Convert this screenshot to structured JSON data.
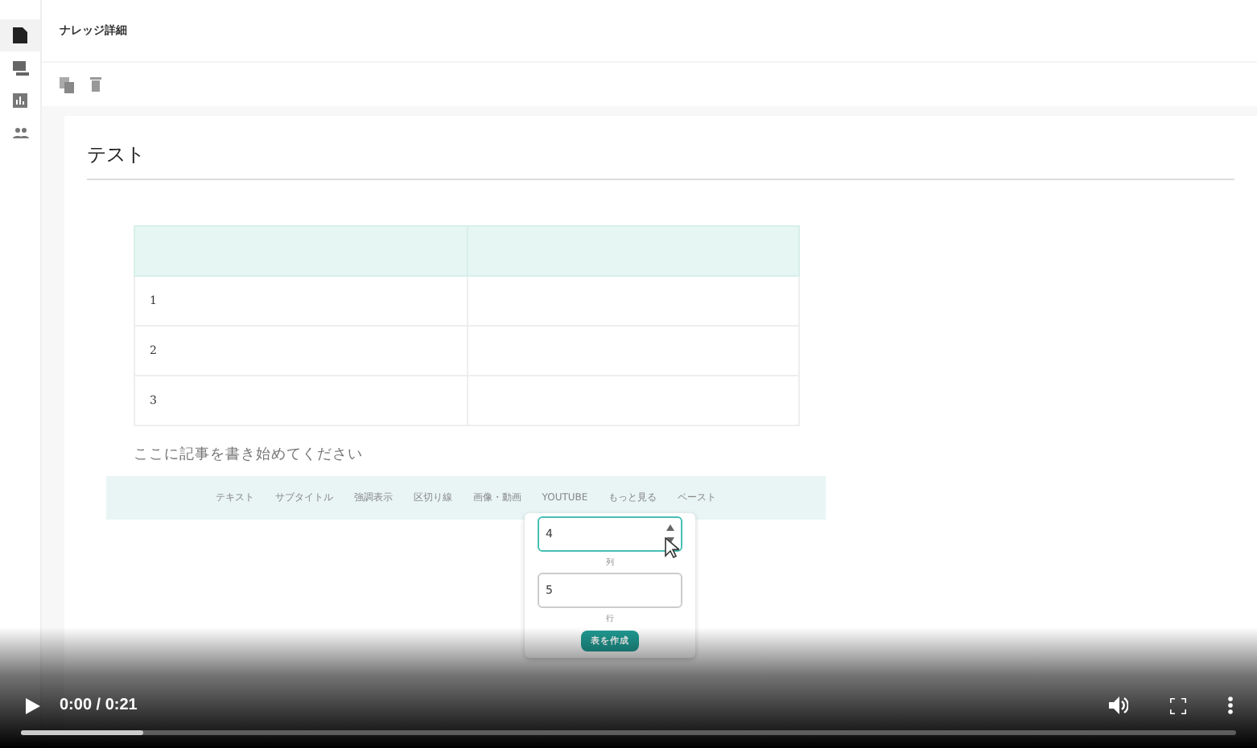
{
  "sidebar": {
    "items": [
      {
        "selected": true
      },
      {
        "selected": false
      },
      {
        "selected": false
      },
      {
        "selected": false
      }
    ]
  },
  "header": {
    "title": "ナレッジ詳細"
  },
  "article": {
    "title": "テスト",
    "table": {
      "rows": [
        [
          "1",
          null
        ],
        [
          "2",
          null
        ],
        [
          "3",
          null
        ]
      ]
    },
    "placeholder": "ここに記事を書き始めてください",
    "insert_toolbar": [
      "テキスト",
      "サブタイトル",
      "強調表示",
      "区切り線",
      "画像・動画",
      "YOUTUBE",
      "もっと見る",
      "ペースト"
    ],
    "table_popup": {
      "columns_value": "4",
      "columns_label": "列",
      "rows_value": "5",
      "rows_label": "行",
      "button": "表を作成"
    }
  },
  "video_player": {
    "time": "0:00 / 0:21",
    "progress": {
      "level": 0.1
    }
  }
}
